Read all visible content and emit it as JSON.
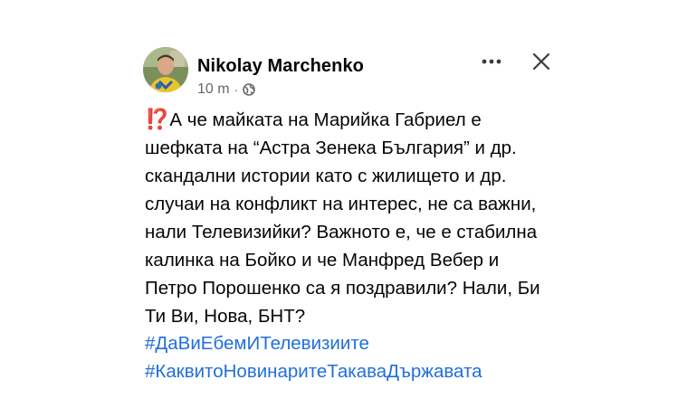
{
  "post": {
    "author": "Nikolay Marchenko",
    "time": "10 m",
    "separator": "·",
    "audience_icon": "globe-icon",
    "more_icon": "more-dots-icon",
    "close_icon": "close-icon",
    "emoji": "⁉️",
    "lines": [
      "А че майката на Марийка Габриел е",
      "шефката на “Астра Зенека България” и др.",
      "скандални истории като с жилището и др.",
      "случаи на конфликт на интерес, не са важни,",
      "нали Телевизийки? Важното е, че е стабилна",
      "калинка на Бойко и че Манфред Вебер и",
      "Петро Порошенко са я поздравили? Нали, Би",
      "Ти Ви, Нова, БНТ?"
    ],
    "hashtags": [
      "#ДаВиЕбемИТелевизиите",
      "#КаквитоНовинаритеТакаваДържавата"
    ]
  },
  "colors": {
    "text": "#050505",
    "meta": "#65676b",
    "hashtag": "#216fdb",
    "emoji": "#e0361a"
  }
}
